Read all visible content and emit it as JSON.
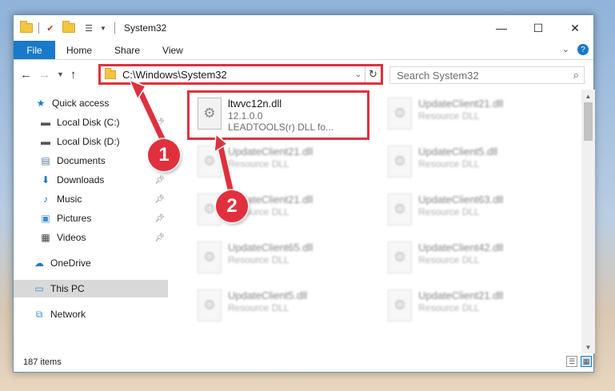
{
  "window": {
    "title": "System32",
    "controls": {
      "minimize": "—",
      "maximize": "☐",
      "close": "✕"
    }
  },
  "ribbon": {
    "tabs": [
      "File",
      "Home",
      "Share",
      "View"
    ],
    "expand_icon": "chevron-down-icon",
    "help_label": "?"
  },
  "address": {
    "path": "C:\\Windows\\System32",
    "search_placeholder": "Search System32"
  },
  "sidebar": {
    "items": [
      {
        "label": "Quick access",
        "icon": "star-icon",
        "pinned": false
      },
      {
        "label": "Local Disk (C:)",
        "icon": "drive-icon",
        "pinned": true
      },
      {
        "label": "Local Disk (D:)",
        "icon": "drive-icon",
        "pinned": true
      },
      {
        "label": "Documents",
        "icon": "document-icon",
        "pinned": true
      },
      {
        "label": "Downloads",
        "icon": "download-icon",
        "pinned": true
      },
      {
        "label": "Music",
        "icon": "music-icon",
        "pinned": true
      },
      {
        "label": "Pictures",
        "icon": "pictures-icon",
        "pinned": true
      },
      {
        "label": "Videos",
        "icon": "video-icon",
        "pinned": true
      },
      {
        "label": "OneDrive",
        "icon": "cloud-icon",
        "pinned": false
      },
      {
        "label": "This PC",
        "icon": "computer-icon",
        "pinned": false,
        "selected": true
      },
      {
        "label": "Network",
        "icon": "network-icon",
        "pinned": false
      }
    ]
  },
  "files": [
    {
      "name": "ltwvc12n.dll",
      "version": "12.1.0.0",
      "description": "LEADTOOLS(r) DLL fo...",
      "highlighted": true
    },
    {
      "name": "UpdateClient21.dll",
      "description": "Resource DLL"
    },
    {
      "name": "UpdateClient21.dll",
      "description": "Resource DLL"
    },
    {
      "name": "UpdateClient5.dll",
      "description": "Resource DLL"
    },
    {
      "name": "UpdateClient21.dll",
      "description": "Resource DLL"
    },
    {
      "name": "UpdateClient63.dll",
      "description": "Resource DLL"
    },
    {
      "name": "UpdateClient65.dll",
      "description": "Resource DLL"
    },
    {
      "name": "UpdateClient42.dll",
      "description": "Resource DLL"
    },
    {
      "name": "UpdateClient5.dll",
      "description": "Resource DLL"
    },
    {
      "name": "UpdateClient21.dll",
      "description": "Resource DLL"
    }
  ],
  "status": {
    "item_count": "187 items"
  },
  "annotations": {
    "step1": "1",
    "step2": "2",
    "color": "#e0303d"
  }
}
